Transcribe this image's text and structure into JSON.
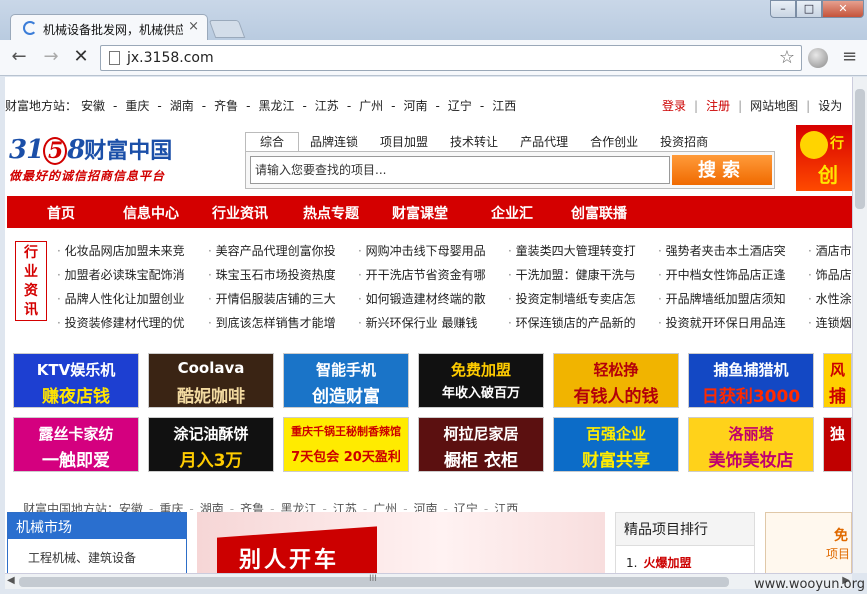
{
  "browser": {
    "tab_title": "机械设备批发网，机械供应",
    "tab_close": "×",
    "window_min": "–",
    "window_max": "□",
    "window_close": "✕",
    "back": "←",
    "forward": "→",
    "stop": "✕",
    "url": "jx.3158.com",
    "star": "☆",
    "menu": "≡"
  },
  "topbar": {
    "label": "财富地方站：",
    "cities": [
      "安徽",
      "重庆",
      "湖南",
      "齐鲁",
      "黑龙江",
      "江苏",
      "广州",
      "河南",
      "辽宁",
      "江西"
    ],
    "login": "登录",
    "register": "注册",
    "sitemap": "网站地图",
    "settings": "设为"
  },
  "logo": {
    "digits_a": "31",
    "digits_b": "5",
    "digits_c": "8",
    "name": "财富中国",
    "slogan": "做最好的诚信招商信息平台"
  },
  "search": {
    "tabs": [
      "综合",
      "品牌连锁",
      "项目加盟",
      "技术转让",
      "产品代理",
      "合作创业",
      "投资招商"
    ],
    "placeholder": "请输入您要查找的项目...",
    "button": "搜索"
  },
  "corner_ad": {
    "a": "行",
    "b": "创"
  },
  "nav": [
    "首页",
    "信息中心",
    "行业资讯",
    "热点专题",
    "财富课堂",
    "企业汇",
    "创富联播"
  ],
  "news": {
    "badge": [
      "行",
      "业",
      "资",
      "讯"
    ],
    "columns": [
      [
        "化妆品网店加盟未来竞",
        "加盟者必读珠宝配饰消",
        "品牌人性化让加盟创业",
        "投资装修建材代理的优"
      ],
      [
        "美容产品代理创富你投",
        "珠宝玉石市场投资热度",
        "开情侣服装店铺的三大",
        "到底该怎样销售才能增"
      ],
      [
        "网购冲击线下母婴用品",
        "开干洗店节省资金有哪",
        "如何锻造建材终端的散",
        "新兴环保行业 最赚钱"
      ],
      [
        "童装类四大管理转变打",
        "干洗加盟：健康干洗与",
        "投资定制墙纸专卖店怎",
        "环保连锁店的产品新的"
      ],
      [
        "强势者夹击本土酒店突",
        "开中档女性饰品店正逢",
        "开品牌墙纸加盟店须知",
        "投资就开环保日用品连"
      ],
      [
        "酒店市",
        "饰品店",
        "水性涂",
        "连锁烟"
      ]
    ]
  },
  "ads_row1": [
    {
      "l1": "KTV娱乐机",
      "l2": "赚夜店钱"
    },
    {
      "l1": "Coolava",
      "l2": "酷妮咖啡"
    },
    {
      "l1": "智能手机",
      "l2": "创造财富"
    },
    {
      "l1": "免费加盟",
      "l2": "年收入破百万"
    },
    {
      "l1": "轻松挣",
      "l2": "有钱人的钱"
    },
    {
      "l1": "捕鱼捕猎机",
      "l2": "日获利3000"
    },
    {
      "l1": "风",
      "l2": "捕"
    }
  ],
  "ads_row2": [
    {
      "l1": "露丝卡家纺",
      "l2": "一触即爱"
    },
    {
      "l1": "涂记油酥饼",
      "l2": "月入3万"
    },
    {
      "l1": "重庆千锅王秘制香辣馆",
      "l2": "7天包会 20天盈利"
    },
    {
      "l1": "柯拉尼家居",
      "l2": "橱柜 衣柜"
    },
    {
      "l1": "百强企业",
      "l2": "财富共享"
    },
    {
      "l1": "洛丽塔",
      "l2": "美饰美妆店"
    },
    {
      "l1": "独",
      "l2": ""
    }
  ],
  "cities2": {
    "label": "财富中国地方站：",
    "cities": [
      "安徽",
      "重庆",
      "湖南",
      "齐鲁",
      "黑龙江",
      "江苏",
      "广州",
      "河南",
      "辽宁",
      "江西"
    ]
  },
  "sidebox": {
    "title": "机械市场",
    "item": "工程机械、建筑设备"
  },
  "banner": {
    "text": "别人开车"
  },
  "rank": {
    "title": "精品项目排行",
    "item_no": "1.",
    "item": "火爆加盟"
  },
  "right_ad": {
    "a": "免",
    "b": "项目"
  },
  "watermark": "www.wooyun.org",
  "scroll_grip": "III"
}
